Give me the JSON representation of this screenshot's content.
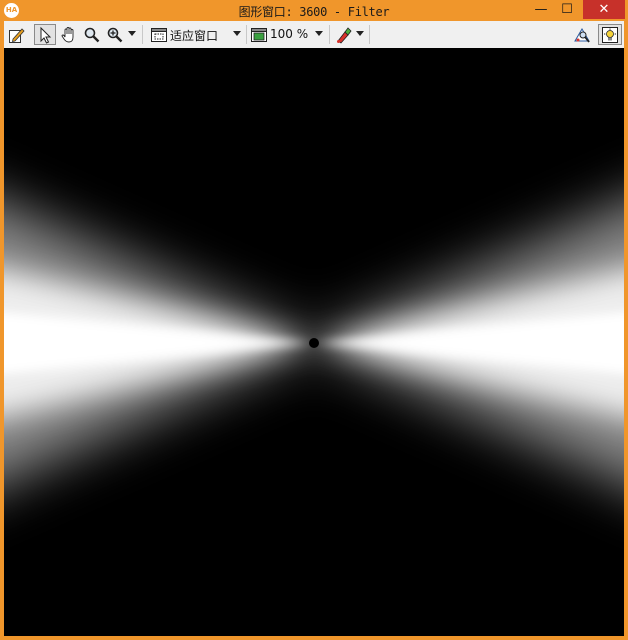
{
  "titlebar": {
    "logo_text": "HA",
    "title": "图形窗口: 3600 - Filter",
    "min": "—",
    "max": "☐",
    "close": "✕"
  },
  "toolbar": {
    "fit_label": "适应窗口",
    "zoom_label": "100 %"
  },
  "icons": [
    "edit-icon",
    "pointer-icon",
    "hand-icon",
    "magnifier-icon",
    "zoom-in-icon",
    "fit-window-icon",
    "zoom-percent-icon",
    "paint-icon",
    "inspect-icon",
    "light-icon"
  ],
  "image": {
    "description": "Bowtie filter: white double cone along horizontal axis on black"
  }
}
